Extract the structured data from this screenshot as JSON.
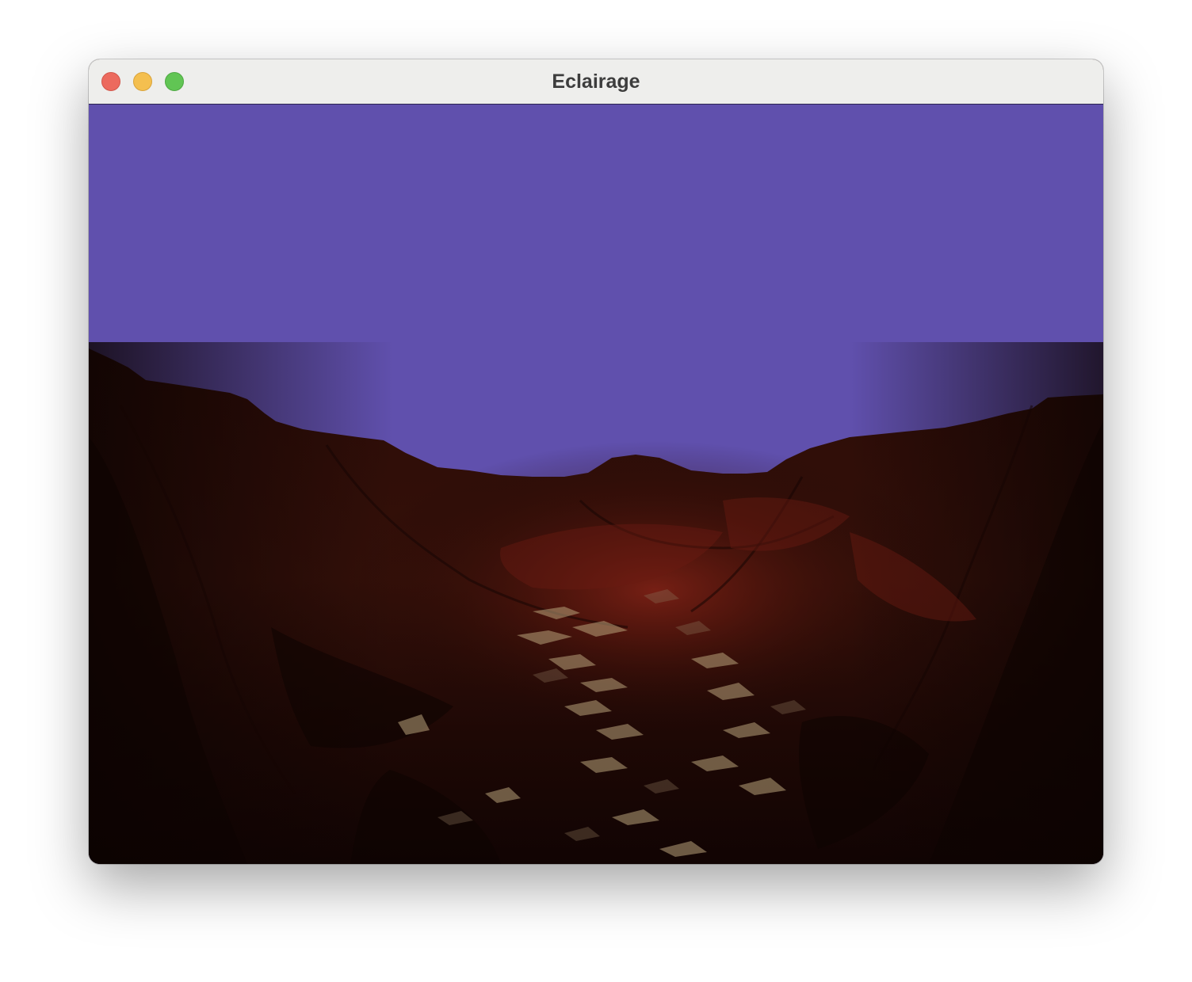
{
  "window": {
    "title": "Eclairage",
    "controls": {
      "close": "close-button",
      "minimize": "minimize-button",
      "zoom": "zoom-button"
    }
  },
  "scene": {
    "sky_color": "#6050ad",
    "terrain_base_color": "#2a0d08",
    "terrain_highlight_color": "#6e1c12",
    "terrain_shadow_color": "#0f0403",
    "specular_color": "#b8a27a"
  }
}
